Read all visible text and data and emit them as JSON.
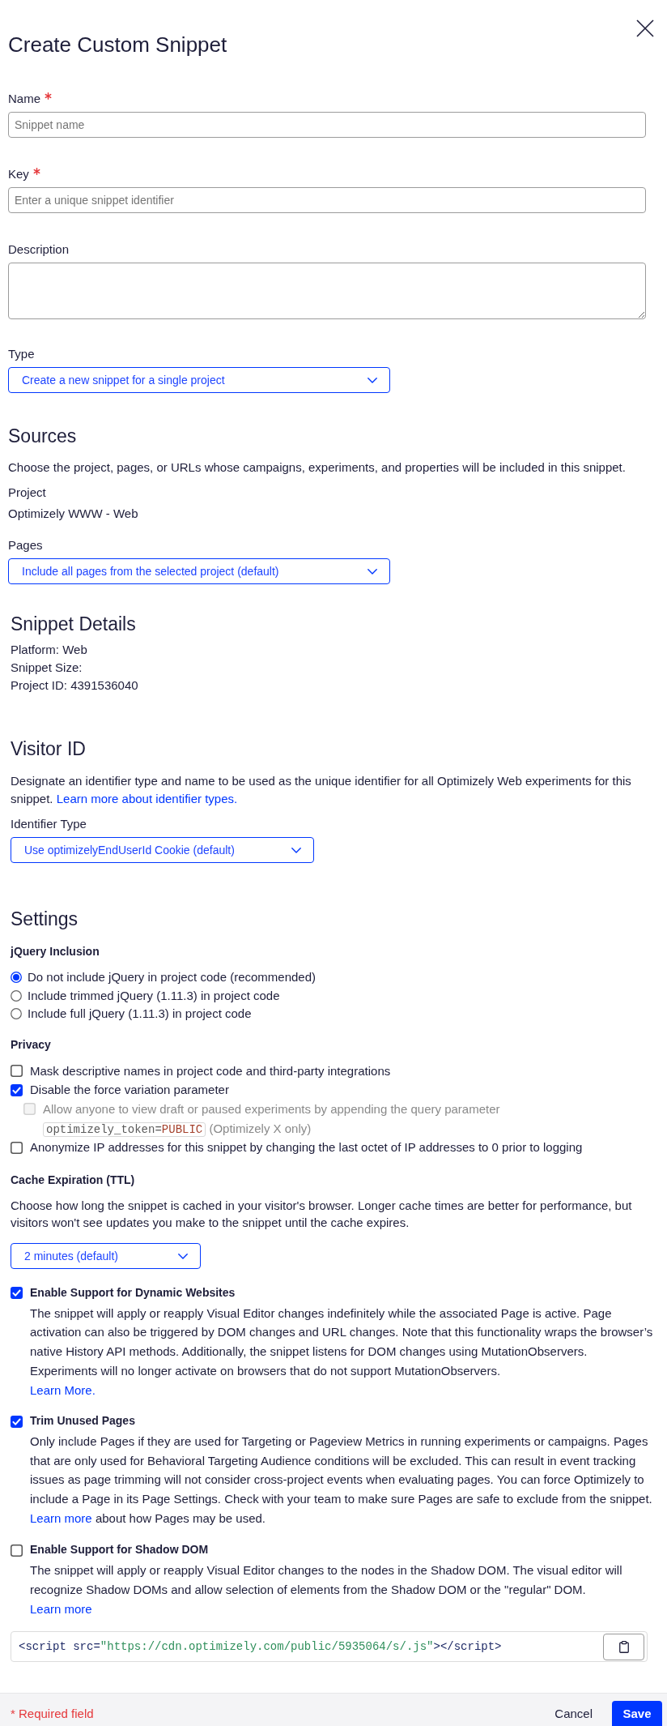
{
  "dialog": {
    "title": "Create Custom Snippet"
  },
  "fields": [
    {
      "kind": "input",
      "label": "Name",
      "required": true,
      "placeholder": "Snippet name"
    },
    {
      "kind": "input",
      "label": "Key",
      "required": true,
      "placeholder": "Enter a unique snippet identifier"
    },
    {
      "kind": "textarea",
      "label": "Description",
      "required": false
    },
    {
      "kind": "select",
      "label": "Type",
      "required": false,
      "value": "Create a new snippet for a single project"
    }
  ],
  "sources": {
    "heading": "Sources",
    "description": "Choose the project, pages, or URLs whose campaigns, experiments, and properties will be included in this snippet.",
    "project": {
      "label": "Project",
      "value": "Optimizely WWW - Web"
    },
    "pages": {
      "kind": "select",
      "label": "Pages",
      "required": false,
      "value": "Include all pages from the selected project (default)"
    }
  },
  "snippet_details": {
    "heading": "Snippet Details",
    "lines": [
      "Platform: Web",
      "Snippet Size:",
      "Project ID: 4391536040"
    ]
  },
  "visitor_id": {
    "heading": "Visitor ID",
    "description": "Designate an identifier type and name to be used as the unique identifier for all Optimizely Web experiments for this snippet.",
    "link": "Learn more about identifier types.",
    "identifier_type": {
      "kind": "select",
      "label": "Identifier Type",
      "required": false,
      "value": "Use optimizelyEndUserId Cookie (default)"
    }
  },
  "settings": {
    "heading": "Settings",
    "jquery_inclusion": {
      "heading": "jQuery Inclusion",
      "options": [
        {
          "label": "Do not include jQuery in project code (recommended)",
          "selected": true
        },
        {
          "label": "Include trimmed jQuery (1.11.3) in project code",
          "selected": false
        },
        {
          "label": "Include full jQuery (1.11.3) in project code",
          "selected": false
        }
      ]
    },
    "privacy": {
      "heading": "Privacy",
      "options": [
        {
          "label": "Mask descriptive names in project code and third-party integrations",
          "checked": false,
          "disabled": false
        },
        {
          "label": "Disable the force variation parameter",
          "checked": true,
          "disabled": false,
          "children": [
            {
              "label": "Allow anyone to view draft or paused experiments by appending the query parameter",
              "code": [
                {
                  "kind": "name",
                  "text": "optimizely_token="
                },
                {
                  "kind": "value",
                  "text": "PUBLIC"
                }
              ],
              "suffix": "(Optimizely X only)",
              "checked": false,
              "disabled": true
            }
          ]
        },
        {
          "label": "Anonymize IP addresses for this snippet by changing the last octet of IP addresses to 0 prior to logging",
          "checked": false,
          "disabled": false
        }
      ]
    },
    "cache_expiration": {
      "heading": "Cache Expiration (TTL)",
      "description": "Choose how long the snippet is cached in your visitor's browser. Longer cache times are better for performance, but visitors won't see updates you make to the snippet until the cache expires.",
      "select": {
        "kind": "select",
        "value": "2 minutes (default)"
      }
    },
    "features": [
      {
        "title": "Enable Support for Dynamic Websites",
        "checked": true,
        "description": "The snippet will apply or reapply Visual Editor changes indefinitely while the associated Page is active. Page activation can also be triggered by DOM changes and URL changes. Note that this functionality wraps the browser’s native History API methods. Additionally, the snippet listens for DOM changes using MutationObservers. Experiments will no longer activate on browsers that do not support MutationObservers.",
        "link": "Learn More."
      },
      {
        "title": "Trim Unused Pages",
        "checked": true,
        "description": "Only include Pages if they are used for Targeting or Pageview Metrics in running experiments or campaigns. Pages that are only used for Behavioral Targeting Audience conditions will be excluded. This can result in event tracking issues as page trimming will not consider cross-project events when evaluating pages. You can force Optimizely to include a Page in its Page Settings. Check with your team to make sure Pages are safe to exclude from the snippet.",
        "link": "Learn more",
        "link_suffix": "about how Pages may be used."
      },
      {
        "title": "Enable Support for Shadow DOM",
        "checked": false,
        "description": "The snippet will apply or reapply Visual Editor changes to the nodes in the Shadow DOM. The visual editor will recognize Shadow DOMs and allow selection of elements from the Shadow DOM or the \"regular\" DOM.",
        "link": "Learn more"
      }
    ]
  },
  "snippet_code": {
    "parts": [
      {
        "kind": "tag",
        "text": "<script src="
      },
      {
        "kind": "string",
        "text": "\"https://cdn.optimizely.com/public/5935064/s/.js\""
      },
      {
        "kind": "tag",
        "text": "></script>"
      }
    ]
  },
  "footer": {
    "note": "* Required field",
    "buttons": [
      {
        "kind": "secondary",
        "label": "Cancel"
      },
      {
        "kind": "primary",
        "label": "Save"
      }
    ]
  }
}
